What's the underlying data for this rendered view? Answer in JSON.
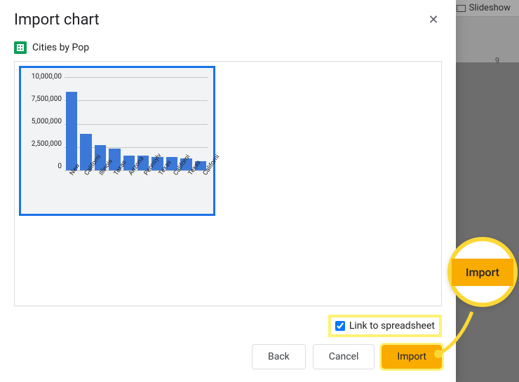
{
  "background": {
    "slideshow_label": "Slideshow",
    "ruler_tick": "9"
  },
  "dialog": {
    "title": "Import chart",
    "close_label": "Close",
    "source_name": "Cities by Pop",
    "link_checkbox_label": "Link to spreadsheet",
    "link_checked": true,
    "buttons": {
      "back": "Back",
      "cancel": "Cancel",
      "import": "Import"
    }
  },
  "callout": {
    "label": "Import"
  },
  "chart_data": {
    "type": "bar",
    "title": "",
    "xlabel": "",
    "ylabel": "",
    "ylim": [
      0,
      10000000
    ],
    "y_ticks": [
      "10,000,00",
      "7,500,000",
      "5,000,000",
      "2,500,000",
      "0"
    ],
    "categories": [
      "New",
      "Californi",
      "Illinois",
      "Texas",
      "Arizona",
      "Pennsylv",
      "Texas",
      "Californi",
      "Texas",
      "Californi"
    ],
    "values": [
      8400000,
      3900000,
      2700000,
      2300000,
      1600000,
      1600000,
      1400000,
      1400000,
      1300000,
      1000000
    ]
  }
}
